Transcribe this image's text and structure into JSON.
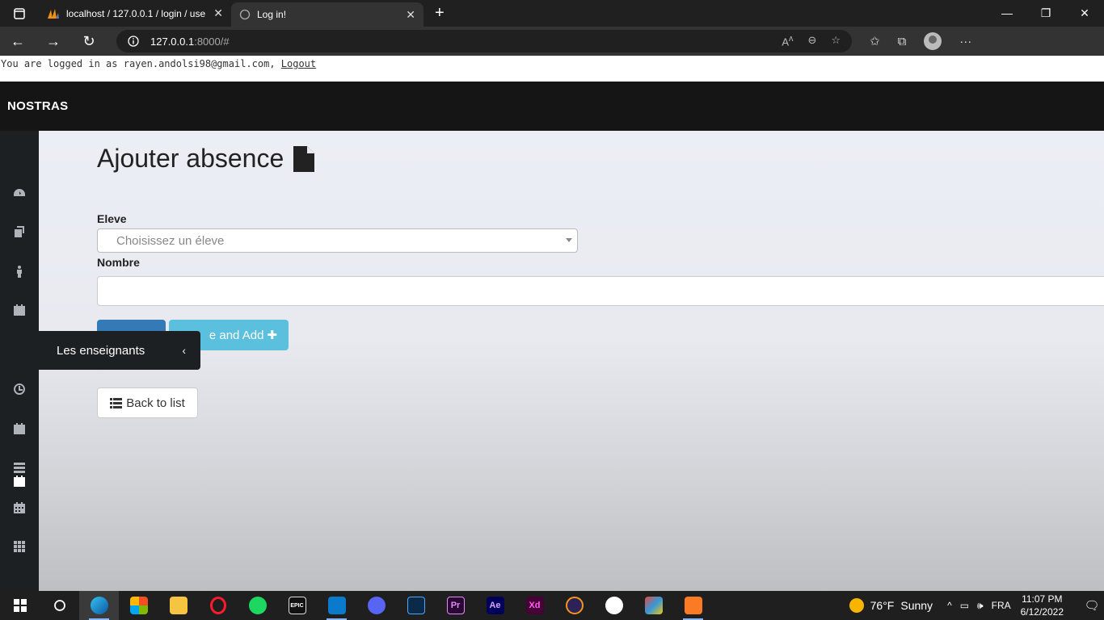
{
  "browser": {
    "tabs": [
      {
        "title": "localhost / 127.0.0.1 / login / use",
        "active": false
      },
      {
        "title": "Log in!",
        "active": true
      }
    ],
    "url_host": "127.0.0.1",
    "url_rest": ":8000/#",
    "new_tab": "+",
    "win_min": "—",
    "win_max": "❐",
    "win_close": "✕",
    "back": "←",
    "forward": "→",
    "reload": "↻",
    "menu": "···"
  },
  "session": {
    "logged_text": "You are logged in as rayen.andolsi98@gmail.com, ",
    "logout_label": "Logout"
  },
  "app": {
    "brand": "NOSTRAS"
  },
  "sidebar": {
    "flyout_label": "Les enseignants",
    "flyout_chevron": "‹"
  },
  "form": {
    "title": "Ajouter absence",
    "eleve_label": "Eleve",
    "eleve_placeholder": "Choisissez un éleve",
    "nombre_label": "Nombre",
    "save_label": "",
    "save_add_label": "e and Add",
    "save_add_icon": "✚",
    "back_label": "Back to list"
  },
  "taskbar": {
    "apps": [
      "Edge",
      "Store",
      "Explorer",
      "Opera",
      "Spotify",
      "Epic Games",
      "VS Code",
      "Discord",
      "App",
      "Pr",
      "Ae",
      "Xd",
      "Eclipse",
      "App",
      "Paint",
      "XAMPP"
    ],
    "weather_temp": "76°F",
    "weather_desc": "Sunny",
    "lang": "FRA",
    "time": "11:07 PM",
    "date": "6/12/2022"
  }
}
